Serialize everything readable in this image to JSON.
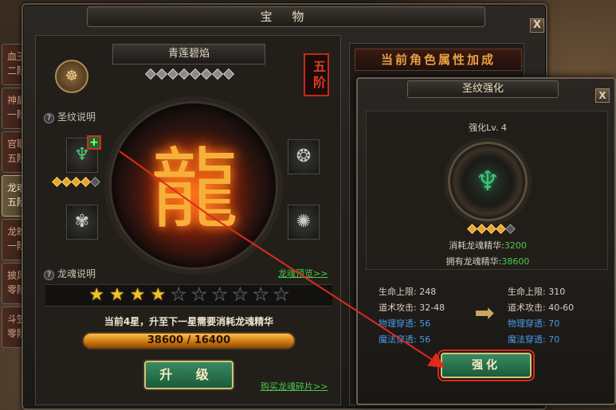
{
  "main": {
    "title": "宝 物",
    "close": "X",
    "treasure_name": "青莲碧焰",
    "rank_badge": "五阶",
    "rune_help": "圣纹说明",
    "soul_help": "龙魂说明",
    "dragon_link": "龙魂预览>>",
    "stars_total": 10,
    "stars_filled": 4,
    "upgrade_text": "当前4星，升至下一星需要消耗龙魂精华",
    "essence_progress": "38600 / 16400",
    "upgrade_button": "升 级",
    "buy_link": "购买龙魂碎片>>"
  },
  "tabs": [
    {
      "line1": "血玉",
      "line2": "二阶"
    },
    {
      "line1": "神盾",
      "line2": "一阶"
    },
    {
      "line1": "官职",
      "line2": "五阶"
    },
    {
      "line1": "龙魂",
      "line2": "五阶"
    },
    {
      "line1": "龙魄",
      "line2": "一阶"
    },
    {
      "line1": "披风",
      "line2": "零阶"
    },
    {
      "line1": "斗笠",
      "line2": "零阶"
    }
  ],
  "attr_panel": {
    "title": "当前角色属性加成"
  },
  "popup": {
    "title": "圣纹强化",
    "close": "X",
    "level": "强化Lv. 4",
    "cost_label": "消耗龙魂精华:",
    "cost_value": "3200",
    "own_label": "拥有龙魂精华:",
    "own_value": "38600",
    "enhance_button": "强化",
    "current": [
      {
        "label": "生命上限:",
        "value": "248",
        "style": "norm"
      },
      {
        "label": "道术攻击:",
        "value": "32-48",
        "style": "norm"
      },
      {
        "label": "物理穿透:",
        "value": "56",
        "style": "blue"
      },
      {
        "label": "魔法穿透:",
        "value": "56",
        "style": "blue"
      }
    ],
    "next": [
      {
        "label": "生命上限:",
        "value": "310",
        "style": "norm"
      },
      {
        "label": "道术攻击:",
        "value": "40-60",
        "style": "norm"
      },
      {
        "label": "物理穿透:",
        "value": "70",
        "style": "blue"
      },
      {
        "label": "魔法穿透:",
        "value": "70",
        "style": "blue"
      }
    ]
  },
  "icons": {
    "beast": "beast-emblem-icon",
    "rune_green": "green-rune-icon",
    "rune_silver": "silver-rune-icon",
    "dragon": "dragon-soul-icon",
    "arrow": "right-arrow-icon"
  },
  "colors": {
    "accent_green": "#4cc84c",
    "highlight_red": "#d82a1a",
    "gold": "#f2c22a"
  }
}
